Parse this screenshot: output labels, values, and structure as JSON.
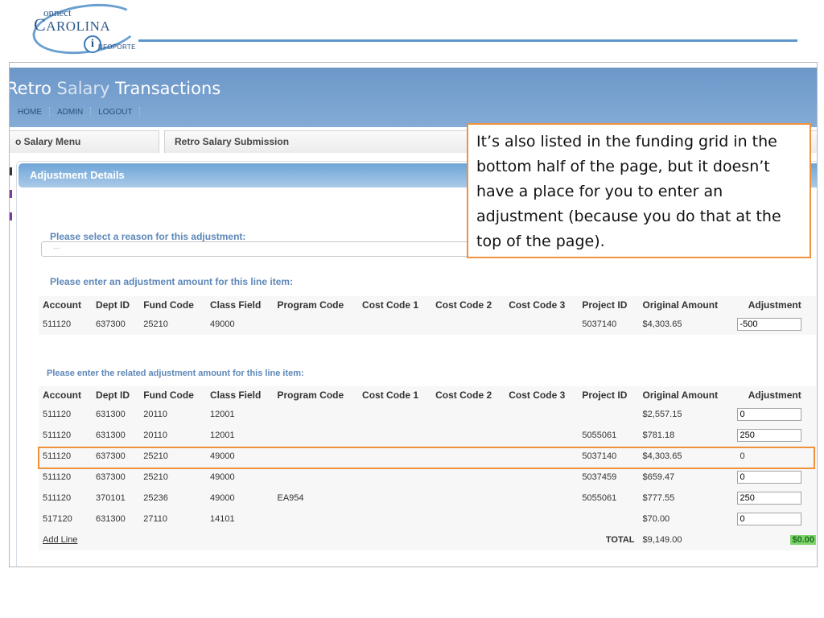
{
  "slide": {
    "logo": {
      "connect": "onnect",
      "carolina": "AROLINA",
      "c_initial": "C",
      "i_glyph": "i",
      "infoporte": "NFOPORTE"
    }
  },
  "app": {
    "title_part1": "Retro ",
    "title_part2": "Salary",
    "title_part3": " Transactions",
    "nav": [
      "HOME",
      "ADMIN",
      "LOGOUT"
    ],
    "tabs": [
      "o Salary Menu",
      "Retro Salary Submission"
    ]
  },
  "panel": {
    "title": "Adjustment Details",
    "reason_label": "Please select a reason for this adjustment:",
    "reason_value": "...",
    "line_item_label": "Please enter an adjustment amount for this line item:",
    "related_label": "Please enter the related adjustment amount for this line item:"
  },
  "columns": [
    "Account",
    "Dept ID",
    "Fund Code",
    "Class Field",
    "Program Code",
    "Cost Code 1",
    "Cost Code 2",
    "Cost Code 3",
    "Project ID",
    "Original Amount",
    "Adjustment"
  ],
  "line_item": {
    "account": "511120",
    "dept_id": "637300",
    "fund_code": "25210",
    "class_field": "49000",
    "program_code": "",
    "cost_code_1": "",
    "cost_code_2": "",
    "cost_code_3": "",
    "project_id": "5037140",
    "original_amount": "$4,303.65",
    "adjustment": "-500"
  },
  "related_rows": [
    {
      "account": "511120",
      "dept_id": "631300",
      "fund_code": "20110",
      "class_field": "12001",
      "program_code": "",
      "project_id": "",
      "original_amount": "$2,557.15",
      "adjustment": "0",
      "editable": true
    },
    {
      "account": "511120",
      "dept_id": "631300",
      "fund_code": "20110",
      "class_field": "12001",
      "program_code": "",
      "project_id": "5055061",
      "original_amount": "$781.18",
      "adjustment": "250",
      "editable": true
    },
    {
      "account": "511120",
      "dept_id": "637300",
      "fund_code": "25210",
      "class_field": "49000",
      "program_code": "",
      "project_id": "5037140",
      "original_amount": "$4,303.65",
      "adjustment": "0",
      "editable": false
    },
    {
      "account": "511120",
      "dept_id": "637300",
      "fund_code": "25210",
      "class_field": "49000",
      "program_code": "",
      "project_id": "5037459",
      "original_amount": "$659.47",
      "adjustment": "0",
      "editable": true
    },
    {
      "account": "511120",
      "dept_id": "370101",
      "fund_code": "25236",
      "class_field": "49000",
      "program_code": "EA954",
      "project_id": "5055061",
      "original_amount": "$777.55",
      "adjustment": "250",
      "editable": true
    },
    {
      "account": "517120",
      "dept_id": "631300",
      "fund_code": "27110",
      "class_field": "14101",
      "program_code": "",
      "project_id": "",
      "original_amount": "$70.00",
      "adjustment": "0",
      "editable": true
    }
  ],
  "footer": {
    "add_line": "Add Line",
    "total_label": "TOTAL",
    "total_amount": "$9,149.00",
    "total_adjustment": "$0.00"
  },
  "callout": {
    "text": "It’s also listed in the funding grid in the bottom half of the page, but it doesn’t have a place for you to enter an adjustment (because you do that at the top of the page)."
  },
  "colors": {
    "highlight": "#f0913c",
    "banner": "#7aa3d1",
    "label_blue": "#5d87b8",
    "total_ok": "#7ed36a"
  }
}
